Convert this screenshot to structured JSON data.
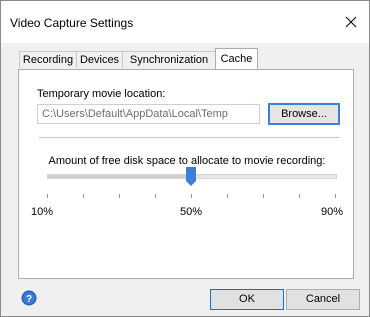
{
  "window": {
    "title": "Video Capture Settings"
  },
  "tabs": [
    {
      "label": "Recording",
      "active": false
    },
    {
      "label": "Devices",
      "active": false
    },
    {
      "label": "Synchronization",
      "active": false
    },
    {
      "label": "Cache",
      "active": true
    }
  ],
  "cache": {
    "temp_label": "Temporary movie location:",
    "temp_path": "C:\\Users\\Default\\AppData\\Local\\Temp",
    "browse_label": "Browse...",
    "disk_label": "Amount of free disk space to allocate to movie recording:",
    "slider": {
      "min_label": "10%",
      "mid_label": "50%",
      "max_label": "90%",
      "min": 10,
      "max": 90,
      "value": 50,
      "tick_count": 9
    }
  },
  "footer": {
    "ok_label": "OK",
    "cancel_label": "Cancel"
  },
  "colors": {
    "accent": "#0078d7",
    "thumb": "#3c7fd6",
    "help": "#2a5eb5"
  }
}
